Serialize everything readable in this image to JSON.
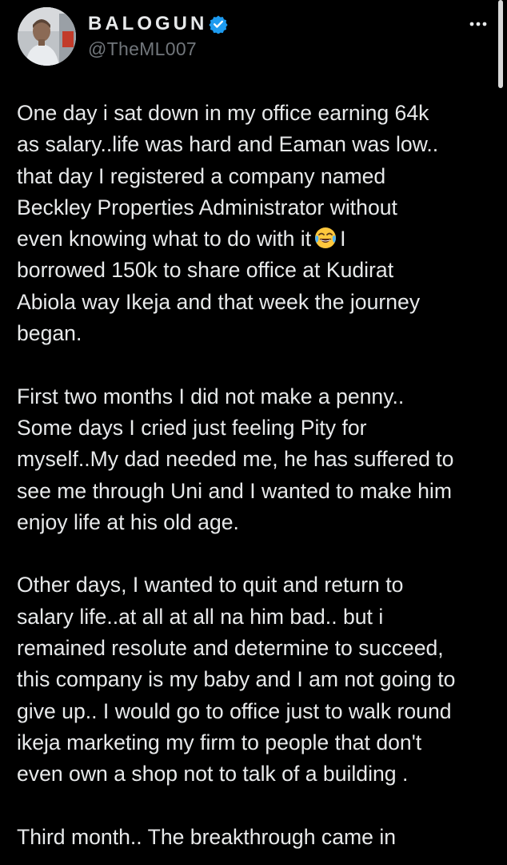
{
  "tweet": {
    "author": {
      "display_name": "BALOGUN",
      "handle": "@TheML007",
      "verified": true,
      "avatar_icon": "profile-photo"
    },
    "more_icon": "ellipsis-icon",
    "verified_color": "#1D9BF0",
    "paragraphs": [
      {
        "lines": [
          "One day i sat down in my  office earning 64k",
          "as salary..life was hard and Eaman was low..",
          "that day I registered a company named",
          "Beckley Properties Administrator without",
          {
            "before": "even knowing what to do with it",
            "emoji": "face-with-tears-of-joy",
            "after": "I"
          },
          "borrowed 150k to share office at Kudirat",
          "Abiola way Ikeja and that week the journey",
          "began."
        ]
      },
      {
        "lines": [
          "First two months I did not make a penny..",
          "Some days I cried just feeling Pity for",
          "myself..My dad needed me, he has suffered to",
          "see me through Uni and I wanted to make him",
          "enjoy life at his old age."
        ]
      },
      {
        "lines": [
          "Other days, I wanted to quit and return to",
          "salary life..at all at all na him bad.. but i",
          "remained resolute and determine to succeed,",
          "this company is my baby and I am not going to",
          "give up.. I would go to office just to walk round",
          "ikeja marketing my firm to people that don't",
          "even own a shop not to talk of a building ."
        ]
      },
      {
        "lines": [
          "Third month.. The breakthrough came in"
        ]
      }
    ]
  }
}
